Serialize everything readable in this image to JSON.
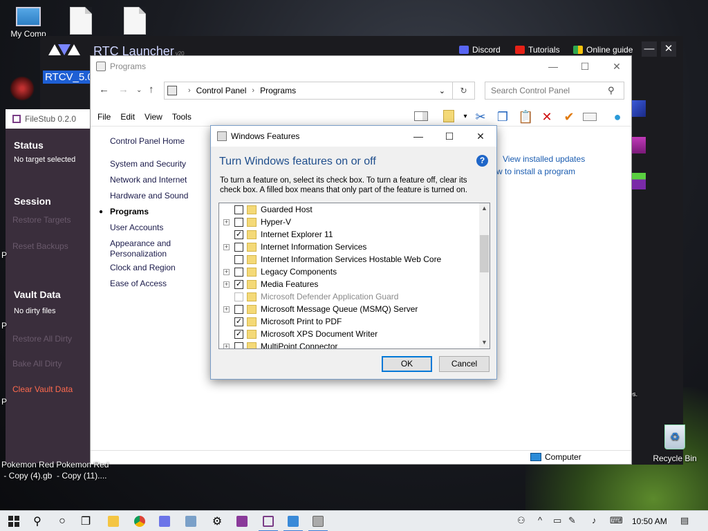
{
  "desktop": {
    "icons": [
      {
        "label": "My Comp"
      },
      {
        "label": ""
      },
      {
        "label": ""
      }
    ],
    "recycle_bin": "Recycle Bin",
    "bottom_files": [
      "Pokemon Red Pokemon Red",
      " - Copy (4).gb  - Copy (11)...."
    ],
    "partial_chars": [
      "P",
      "P",
      "P",
      "es."
    ]
  },
  "rtc_launcher": {
    "title": "RTC Launcher",
    "version": "v20",
    "nav": [
      "Discord",
      "Tutorials",
      "Online guide"
    ],
    "window_controls": [
      "—",
      "✕"
    ],
    "rtcv_label": "RTCV_5.0"
  },
  "filestub": {
    "title": "FileStub 0.2.0",
    "status_heading": "Status",
    "status_text": "No target selected",
    "session_heading": "Session",
    "restore_targets": "Restore Targets",
    "reset_backups": "Reset Backups",
    "vault_heading": "Vault Data",
    "vault_text": "No dirty files",
    "restore_all_dirty": "Restore All Dirty",
    "bake_all_dirty": "Bake All Dirty",
    "clear_vault": "Clear Vault Data"
  },
  "control_panel": {
    "title": "Programs",
    "window_controls": [
      "—",
      "☐",
      "✕"
    ],
    "breadcrumb": [
      "Control Panel",
      "Programs"
    ],
    "search_placeholder": "Search Control Panel",
    "menu": [
      "File",
      "Edit",
      "View",
      "Tools"
    ],
    "sidebar": [
      {
        "label": "Control Panel Home"
      },
      {
        "label": "System and Security"
      },
      {
        "label": "Network and Internet"
      },
      {
        "label": "Hardware and Sound"
      },
      {
        "label": "Programs",
        "active": true
      },
      {
        "label": "User Accounts"
      },
      {
        "label": "Appearance and Personalization"
      },
      {
        "label": "Clock and Region"
      },
      {
        "label": "Ease of Access"
      }
    ],
    "links": [
      "View installed updates",
      "w to install a program"
    ],
    "status_bar": "Computer"
  },
  "windows_features": {
    "title": "Windows Features",
    "window_controls": [
      "—",
      "☐",
      "✕"
    ],
    "heading": "Turn Windows features on or off",
    "description": "To turn a feature on, select its check box. To turn a feature off, clear its check box. A filled box means that only part of the feature is turned on.",
    "features": [
      {
        "label": "Guarded Host",
        "expandable": false,
        "checked": false,
        "disabled": false
      },
      {
        "label": "Hyper-V",
        "expandable": true,
        "checked": false,
        "disabled": false
      },
      {
        "label": "Internet Explorer 11",
        "expandable": false,
        "checked": true,
        "disabled": false
      },
      {
        "label": "Internet Information Services",
        "expandable": true,
        "checked": false,
        "disabled": false
      },
      {
        "label": "Internet Information Services Hostable Web Core",
        "expandable": false,
        "checked": false,
        "disabled": false
      },
      {
        "label": "Legacy Components",
        "expandable": true,
        "checked": false,
        "disabled": false
      },
      {
        "label": "Media Features",
        "expandable": true,
        "checked": true,
        "disabled": false
      },
      {
        "label": "Microsoft Defender Application Guard",
        "expandable": false,
        "checked": false,
        "disabled": true
      },
      {
        "label": "Microsoft Message Queue (MSMQ) Server",
        "expandable": true,
        "checked": false,
        "disabled": false
      },
      {
        "label": "Microsoft Print to PDF",
        "expandable": false,
        "checked": true,
        "disabled": false
      },
      {
        "label": "Microsoft XPS Document Writer",
        "expandable": false,
        "checked": true,
        "disabled": false
      },
      {
        "label": "MultiPoint Connector",
        "expandable": true,
        "checked": false,
        "disabled": false
      }
    ],
    "ok_label": "OK",
    "cancel_label": "Cancel"
  },
  "taskbar": {
    "clock": "10:50 AM"
  },
  "colors": {
    "accent": "#0078d7",
    "link": "#1a5cb0",
    "heading_blue": "#1f4e8c",
    "filestub_bg": "#3a2e3c",
    "filestub_red": "#ff6a4e"
  }
}
